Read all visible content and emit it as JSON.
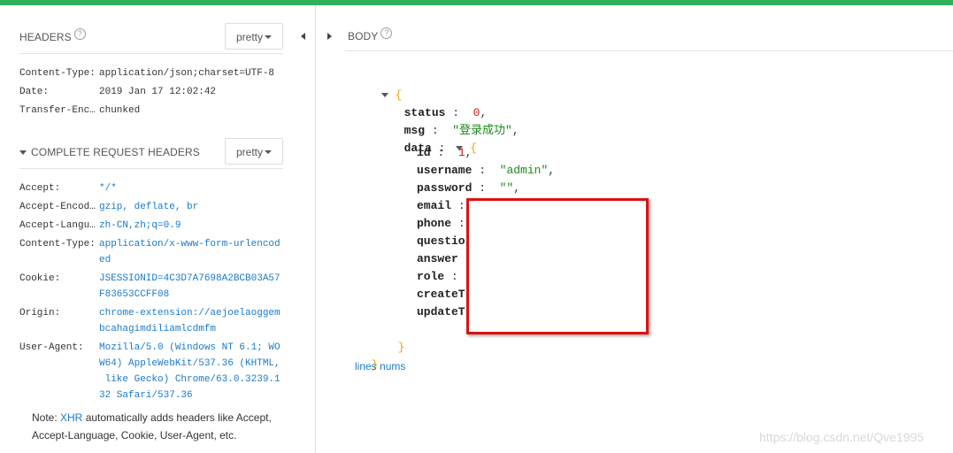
{
  "headers": {
    "title": "HEADERS",
    "help": "?",
    "format": "pretty",
    "rows": [
      {
        "key": "Content-Type:",
        "value": "application/json;charset=UTF-8"
      },
      {
        "key": "Date:",
        "value": "2019 Jan 17 12:02:42"
      },
      {
        "key": "Transfer-Enc…",
        "value": "chunked"
      }
    ]
  },
  "request_headers": {
    "title": "COMPLETE REQUEST HEADERS",
    "format": "pretty",
    "rows": [
      {
        "key": "Accept:",
        "value": "*/*"
      },
      {
        "key": "Accept-Encod…",
        "value": "gzip, deflate, br"
      },
      {
        "key": "Accept-Langu…",
        "value": "zh-CN,zh;q=0.9"
      },
      {
        "key": "Content-Type:",
        "value": "application/x-www-form-urlencod\ned"
      },
      {
        "key": "Cookie:",
        "value": "JSESSIONID=4C3D7A7698A2BCB03A57\nF83653CCFF08"
      },
      {
        "key": "Origin:",
        "value": "chrome-extension://aejoelaoggem\nbcahagimdiliamlcdmfm"
      },
      {
        "key": "User-Agent:",
        "value": "Mozilla/5.0 (Windows NT 6.1; WO\nW64) AppleWebKit/537.36 (KHTML,\n like Gecko) Chrome/63.0.3239.1\n32 Safari/537.36"
      }
    ],
    "note_prefix": "Note: ",
    "note_link": "XHR",
    "note_text": " automatically adds headers like Accept, Accept-Language, Cookie, User-Agent, etc."
  },
  "body": {
    "title": "BODY",
    "help": "?",
    "open_brace": "{",
    "close_brace": "}",
    "lines_link": "lines nums",
    "fields": {
      "status": {
        "key": "status",
        "sep": " :  ",
        "value": "0",
        "trail": ","
      },
      "msg": {
        "key": "msg",
        "sep": " :  ",
        "value": "\"登录成功\"",
        "trail": ","
      },
      "data": {
        "key": "data",
        "sep": " : "
      }
    },
    "data_fields": [
      {
        "key": "id",
        "sep": " :  ",
        "value": "1",
        "trail": ",",
        "kind": "num"
      },
      {
        "key": "username",
        "sep": " :  ",
        "value": "\"admin\"",
        "trail": ",",
        "kind": "str"
      },
      {
        "key": "password",
        "sep": " :  ",
        "value": "\"\"",
        "trail": ",",
        "kind": "str"
      },
      {
        "key": "email",
        "sep": " : ",
        "value": "",
        "trail": "",
        "kind": "str"
      },
      {
        "key": "phone",
        "sep": " : ",
        "value": "",
        "trail": "",
        "kind": "str"
      },
      {
        "key": "questio",
        "sep": "",
        "value": "",
        "trail": "",
        "kind": "str"
      },
      {
        "key": "answer",
        "sep": "",
        "value": "",
        "trail": "",
        "kind": "str"
      },
      {
        "key": "role",
        "sep": " : ",
        "value": "",
        "trail": "",
        "kind": "str"
      },
      {
        "key": "createT",
        "sep": "",
        "value": "",
        "trail": "",
        "kind": "str"
      },
      {
        "key": "updateT",
        "sep": "",
        "value": "",
        "trail": "",
        "kind": "str"
      }
    ]
  },
  "watermark": "https://blog.csdn.net/Qve1995",
  "colors": {
    "accent": "#2fb15b",
    "link": "#1b79c9",
    "number": "#c41a16",
    "string": "#1a8a1a",
    "brace": "#e8a400",
    "redact": "#e01010"
  }
}
